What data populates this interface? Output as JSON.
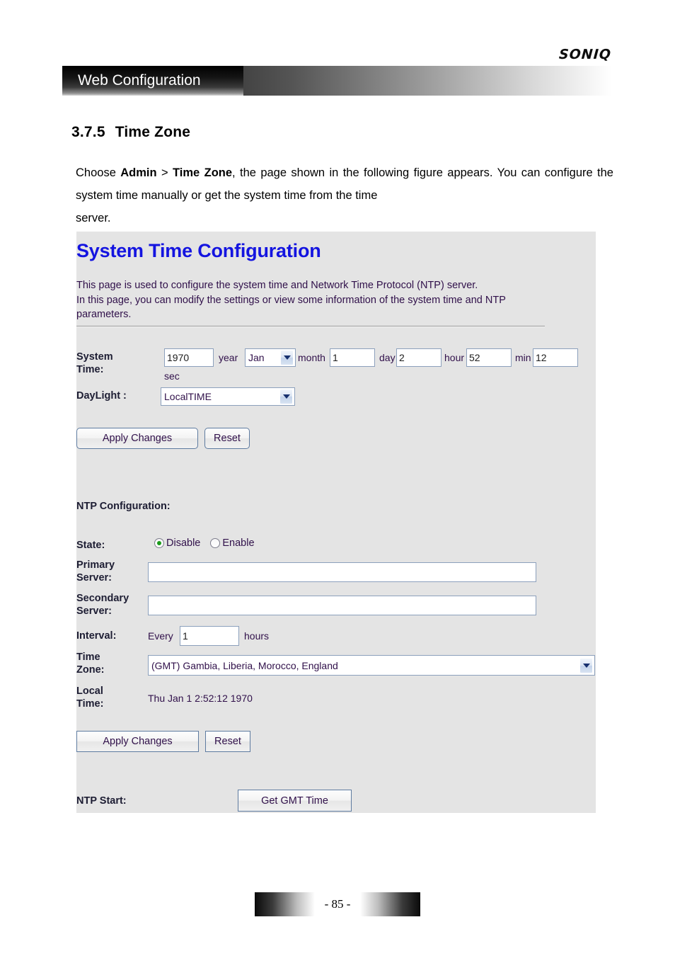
{
  "document": {
    "header_banner": "Web Configuration",
    "brand_logo": "SONIQ",
    "section_number": "3.7.5",
    "section_title": "Time Zone",
    "paragraph": {
      "part1": "Choose ",
      "bold1": "Admin",
      "part2": " > ",
      "bold2": "Time Zone",
      "part3": ", the page shown in the following figure appears. You can configure the system time manually or get the system time from the time",
      "part4": "server."
    },
    "page_number": "- 85 -"
  },
  "screenshot": {
    "title": "System Time Configuration",
    "description_line1": "This page is used to configure the system time and Network Time Protocol (NTP) server.",
    "description_line2": "In this page, you can modify the settings or view some information of the system time and NTP",
    "description_line3": "parameters.",
    "system_time": {
      "label_line1": "System",
      "label_line2": "Time:",
      "year_value": "1970",
      "year_unit": "year",
      "month_value": "Jan",
      "month_unit": "month",
      "day_value": "1",
      "day_unit": "day",
      "hour_value": "2",
      "hour_unit": "hour",
      "min_value": "52",
      "min_unit": "min",
      "sec_value": "12",
      "sec_unit": "sec"
    },
    "daylight": {
      "label": "DayLight :",
      "value": "LocalTIME"
    },
    "top_buttons": {
      "apply": "Apply Changes",
      "reset": "Reset"
    },
    "ntp": {
      "heading": "NTP Configuration:",
      "state_label": "State:",
      "state_disable": "Disable",
      "state_enable": "Enable",
      "state_selected": "Disable",
      "primary_label_line1": "Primary",
      "primary_label_line2": "Server:",
      "primary_value": "",
      "secondary_label_line1": "Secondary",
      "secondary_label_line2": "Server:",
      "secondary_value": "",
      "interval_label": "Interval:",
      "interval_prefix": "Every",
      "interval_value": "1",
      "interval_suffix": "hours",
      "timezone_label_line1": "Time",
      "timezone_label_line2": "Zone:",
      "timezone_value": "(GMT) Gambia, Liberia, Morocco, England",
      "localtime_label_line1": "Local",
      "localtime_label_line2": "Time:",
      "localtime_value": "Thu Jan 1 2:52:12 1970"
    },
    "bottom_buttons": {
      "apply": "Apply Changes",
      "reset": "Reset"
    },
    "ntp_start": {
      "label": "NTP Start:",
      "button": "Get GMT Time"
    },
    "colors": {
      "title_blue": "#1414e0",
      "panel_bg": "#e4e4e4",
      "label_text": "#1d1d33",
      "value_text": "#30104a",
      "radio_dot_green": "#1a9a1a"
    }
  }
}
